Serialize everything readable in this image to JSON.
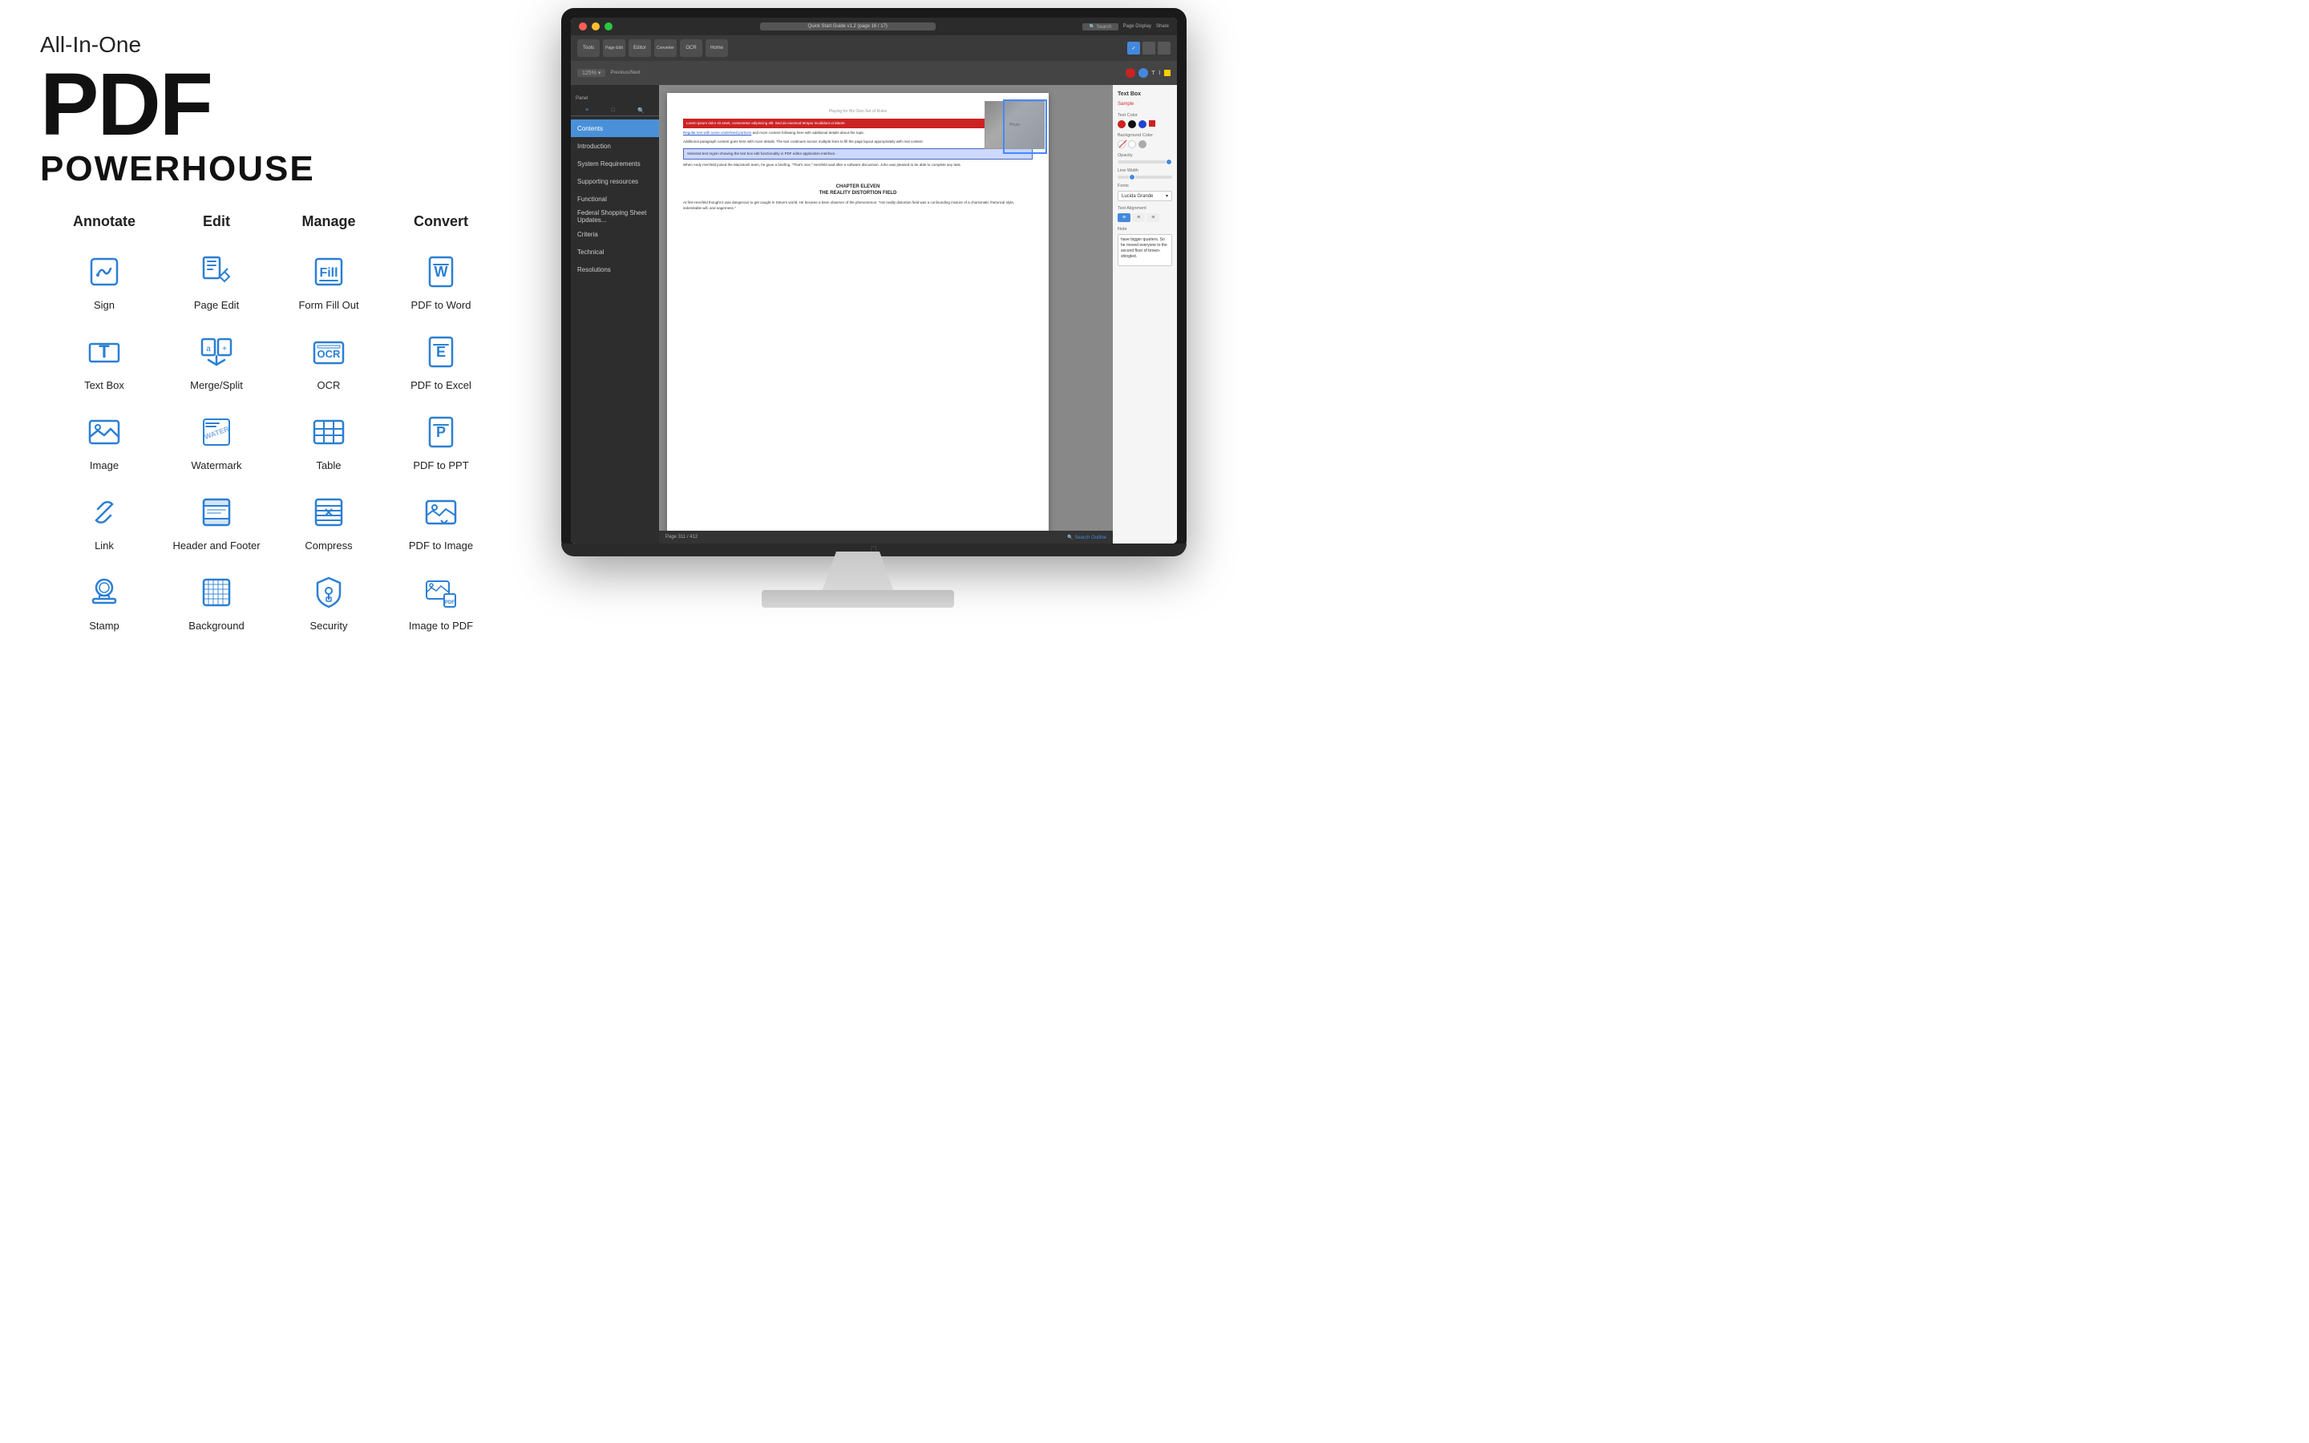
{
  "header": {
    "tagline_small": "All-In-One",
    "tagline_pdf": "PDF",
    "tagline_powerhouse": "POWERHOUSE"
  },
  "categories": [
    {
      "label": "Annotate"
    },
    {
      "label": "Edit"
    },
    {
      "label": "Manage"
    },
    {
      "label": "Convert"
    }
  ],
  "features": [
    {
      "col": 0,
      "label": "Sign",
      "icon": "sign"
    },
    {
      "col": 1,
      "label": "Page Edit",
      "icon": "page-edit"
    },
    {
      "col": 2,
      "label": "Form Fill Out",
      "icon": "form-fill"
    },
    {
      "col": 3,
      "label": "PDF to Word",
      "icon": "pdf-word"
    },
    {
      "col": 0,
      "label": "Text Box",
      "icon": "text-box"
    },
    {
      "col": 1,
      "label": "Merge/Split",
      "icon": "merge-split"
    },
    {
      "col": 2,
      "label": "OCR",
      "icon": "ocr"
    },
    {
      "col": 3,
      "label": "PDF to Excel",
      "icon": "pdf-excel"
    },
    {
      "col": 0,
      "label": "Image",
      "icon": "image"
    },
    {
      "col": 1,
      "label": "Watermark",
      "icon": "watermark"
    },
    {
      "col": 2,
      "label": "Table",
      "icon": "table"
    },
    {
      "col": 3,
      "label": "PDF to PPT",
      "icon": "pdf-ppt"
    },
    {
      "col": 0,
      "label": "Link",
      "icon": "link"
    },
    {
      "col": 1,
      "label": "Header and Footer",
      "icon": "header-footer"
    },
    {
      "col": 2,
      "label": "Compress",
      "icon": "compress"
    },
    {
      "col": 3,
      "label": "PDF to Image",
      "icon": "pdf-image"
    },
    {
      "col": 0,
      "label": "Stamp",
      "icon": "stamp"
    },
    {
      "col": 1,
      "label": "Background",
      "icon": "background"
    },
    {
      "col": 2,
      "label": "Security",
      "icon": "security"
    },
    {
      "col": 3,
      "label": "Image to PDF",
      "icon": "image-pdf"
    }
  ],
  "screen": {
    "title": "Quick Start Guide v1.2 (page 16 / 17)",
    "panel_title": "Text Box",
    "panel_sample": "Sample",
    "search_placeholder": "Search",
    "zoom": "125%",
    "page_info": "Page 311 / 412"
  }
}
